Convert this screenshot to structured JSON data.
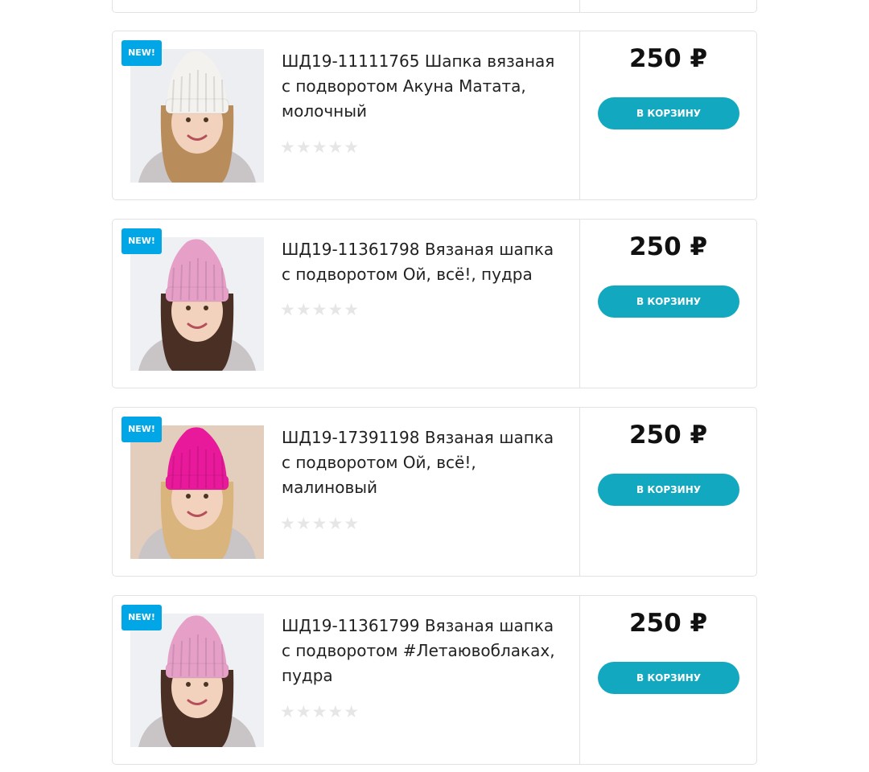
{
  "products": [
    {
      "badge": "NEW!",
      "title": "ШД19-11111765 Шапка вязаная с подворотом Акуна Матата, молочный",
      "stars": "★★★★★",
      "price": "250 ₽",
      "cart_label": "В КОРЗИНУ",
      "hat_color": "#f4f2ee",
      "bg_color": "#eceef2",
      "hair_color": "#b98c5c"
    },
    {
      "badge": "NEW!",
      "title": "ШД19-11361798 Вязаная шапка с подворотом Ой, всё!, пудра",
      "stars": "★★★★★",
      "price": "250 ₽",
      "cart_label": "В КОРЗИНУ",
      "hat_color": "#e6a0c8",
      "bg_color": "#eef0f4",
      "hair_color": "#4a3024"
    },
    {
      "badge": "NEW!",
      "title": "ШД19-17391198 Вязаная шапка с подворотом Ой, всё!, малиновый",
      "stars": "★★★★★",
      "price": "250 ₽",
      "cart_label": "В КОРЗИНУ",
      "hat_color": "#e8199a",
      "bg_color": "#e3cdbd",
      "hair_color": "#d9b47c"
    },
    {
      "badge": "NEW!",
      "title": "ШД19-11361799 Вязаная шапка с подворотом #Летаювоблаках, пудра",
      "stars": "★★★★★",
      "price": "250 ₽",
      "cart_label": "В КОРЗИНУ",
      "hat_color": "#e6a0c8",
      "bg_color": "#eef0f4",
      "hair_color": "#4a3024"
    }
  ]
}
